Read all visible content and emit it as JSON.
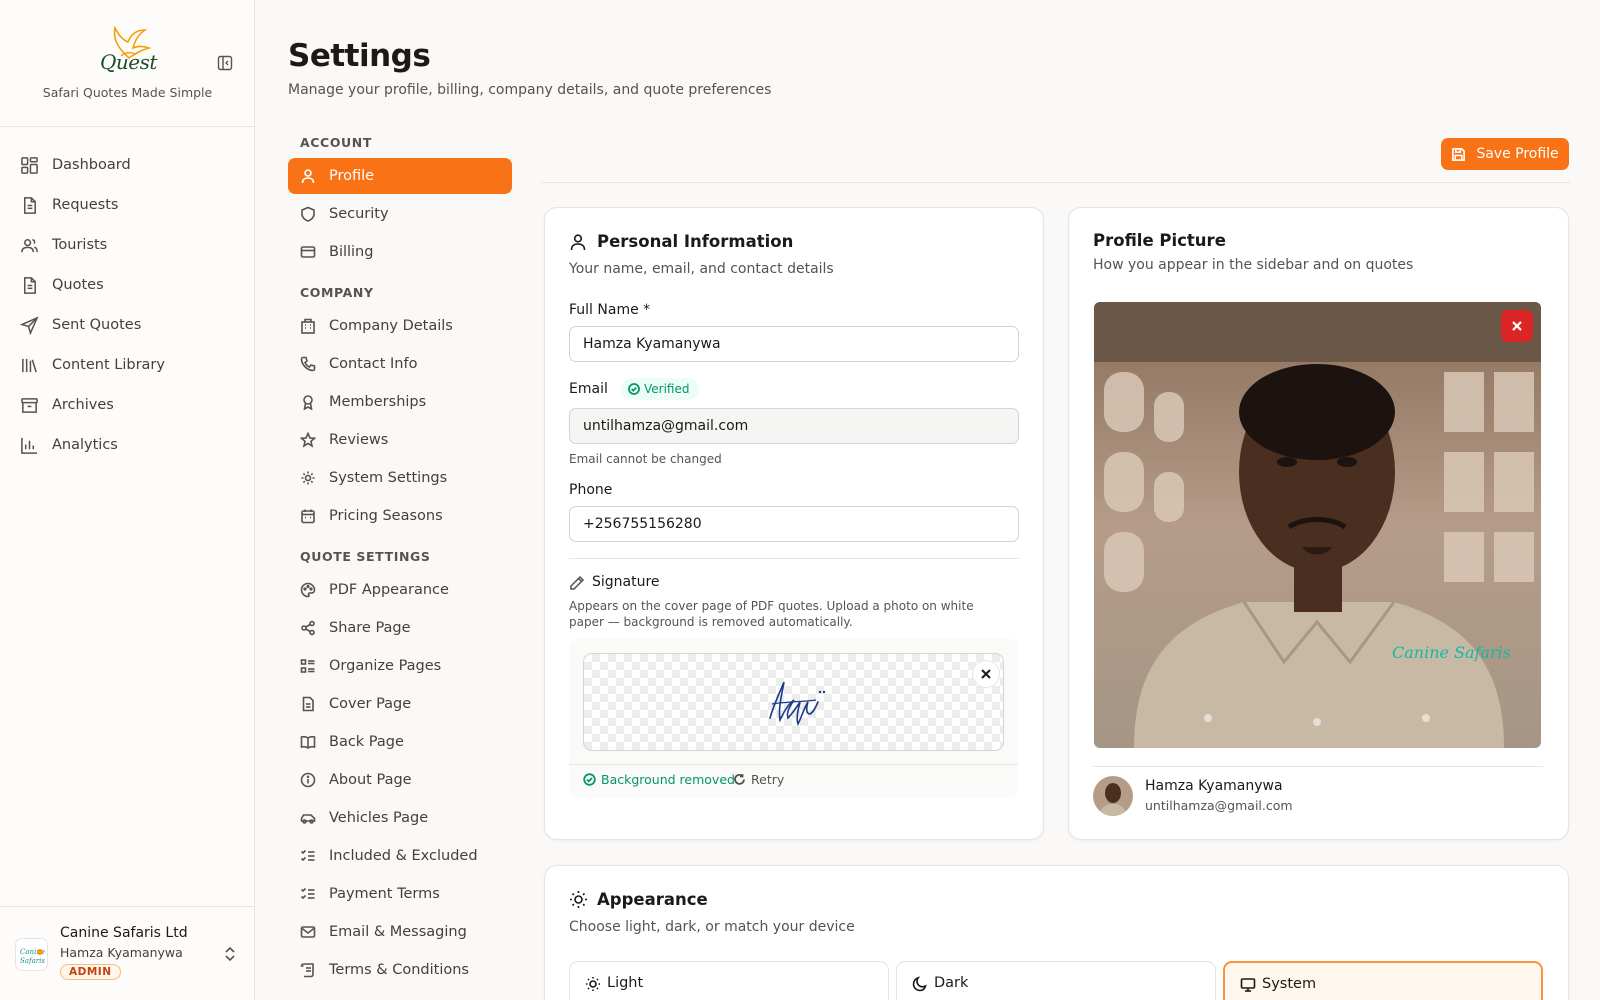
{
  "brand": {
    "logo_text": "Quest",
    "tagline": "Safari Quotes Made Simple"
  },
  "sidebar": {
    "items": [
      {
        "label": "Dashboard",
        "icon": "dashboard-icon"
      },
      {
        "label": "Requests",
        "icon": "document-icon"
      },
      {
        "label": "Tourists",
        "icon": "users-icon"
      },
      {
        "label": "Quotes",
        "icon": "document-icon"
      },
      {
        "label": "Sent Quotes",
        "icon": "send-icon"
      },
      {
        "label": "Content Library",
        "icon": "library-icon"
      },
      {
        "label": "Archives",
        "icon": "archive-icon"
      },
      {
        "label": "Analytics",
        "icon": "bar-chart-icon"
      }
    ]
  },
  "account": {
    "company": "Canine Safaris Ltd",
    "user": "Hamza Kyamanywa",
    "role": "ADMIN",
    "logo_text": "Canine Safaris"
  },
  "header": {
    "title": "Settings",
    "subtitle": "Manage your profile, billing, company details, and quote preferences"
  },
  "settings_nav": {
    "account_heading": "ACCOUNT",
    "account": [
      {
        "label": "Profile",
        "active": true
      },
      {
        "label": "Security"
      },
      {
        "label": "Billing"
      }
    ],
    "company_heading": "COMPANY",
    "company": [
      {
        "label": "Company Details"
      },
      {
        "label": "Contact Info"
      },
      {
        "label": "Memberships"
      },
      {
        "label": "Reviews"
      },
      {
        "label": "System Settings"
      },
      {
        "label": "Pricing Seasons"
      }
    ],
    "quote_heading": "QUOTE SETTINGS",
    "quote": [
      {
        "label": "PDF Appearance"
      },
      {
        "label": "Share Page"
      },
      {
        "label": "Organize Pages"
      },
      {
        "label": "Cover Page"
      },
      {
        "label": "Back Page"
      },
      {
        "label": "About Page"
      },
      {
        "label": "Vehicles Page"
      },
      {
        "label": "Included & Excluded"
      },
      {
        "label": "Payment Terms"
      },
      {
        "label": "Email & Messaging"
      },
      {
        "label": "Terms & Conditions"
      }
    ]
  },
  "toolbar": {
    "save_label": "Save Profile"
  },
  "personal": {
    "title": "Personal Information",
    "subtitle": "Your name, email, and contact details",
    "full_name_label": "Full Name *",
    "full_name": "Hamza Kyamanywa",
    "email_label": "Email",
    "verified_label": "Verified",
    "email": "untilhamza@gmail.com",
    "email_help": "Email cannot be changed",
    "phone_label": "Phone",
    "phone": "+256755156280",
    "signature_title": "Signature",
    "signature_desc": "Appears on the cover page of PDF quotes. Upload a photo on white paper — background is removed automatically.",
    "bg_removed": "Background removed",
    "retry": "Retry"
  },
  "picture": {
    "title": "Profile Picture",
    "subtitle": "How you appear in the sidebar and on quotes",
    "shirt_text": "Canine Safaris",
    "name": "Hamza Kyamanywa",
    "email": "untilhamza@gmail.com"
  },
  "appearance": {
    "title": "Appearance",
    "subtitle": "Choose light, dark, or match your device",
    "options": [
      {
        "label": "Light"
      },
      {
        "label": "Dark"
      },
      {
        "label": "System",
        "selected": true
      }
    ]
  },
  "colors": {
    "accent": "#f97316",
    "success": "#059669",
    "danger": "#dc2626"
  }
}
